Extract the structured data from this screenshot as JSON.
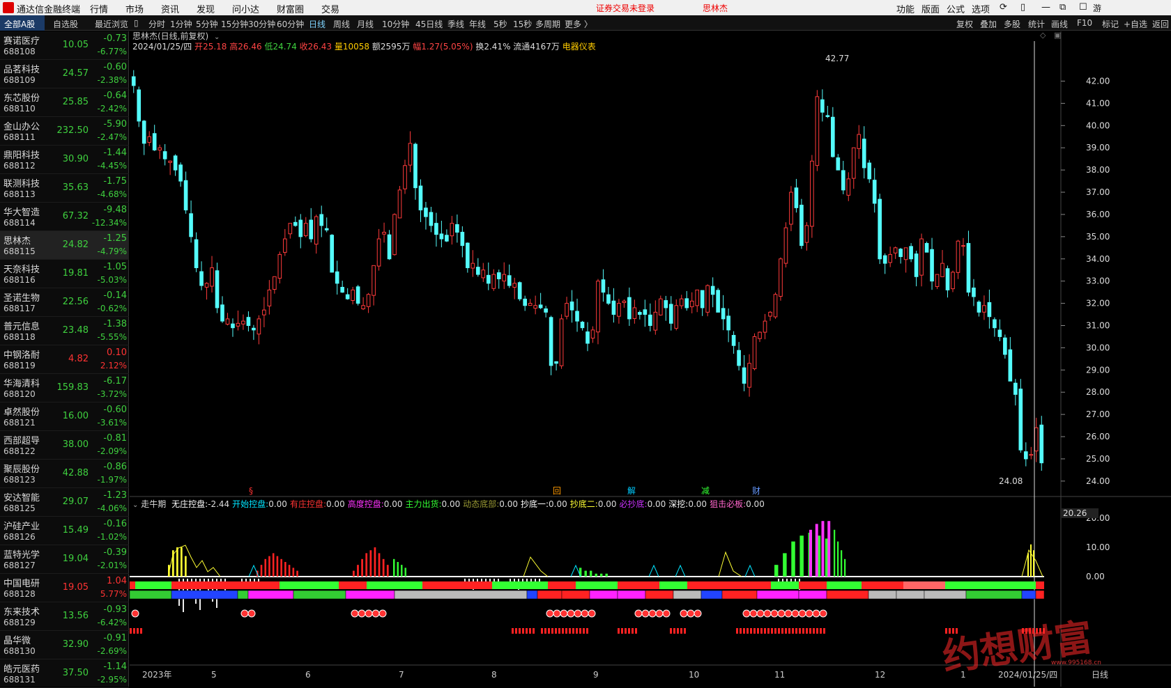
{
  "menubar": {
    "app_title": "通达信金融终端",
    "items": [
      "行情",
      "市场",
      "资讯",
      "发现",
      "问小达",
      "财富圈",
      "交易"
    ],
    "notice": "证券交易未登录",
    "current_stock": "思林杰",
    "tools": [
      "功能",
      "版面",
      "公式",
      "选项"
    ],
    "user": "游客"
  },
  "left_tabs": [
    "全部A股",
    "自选股",
    "最近浏览"
  ],
  "period_tabs": [
    "分时",
    "1分钟",
    "5分钟",
    "15分钟",
    "30分钟",
    "60分钟",
    "日线",
    "周线",
    "月线",
    "10分钟",
    "45日线",
    "季线",
    "年线",
    "5秒",
    "15秒",
    "多周期",
    "更多 〉"
  ],
  "active_period": "日线",
  "right_buttons": [
    "复权",
    "叠加",
    "多股",
    "统计",
    "画线",
    "F10",
    "标记",
    "+自选",
    "返回"
  ],
  "stocks": [
    {
      "name": "赛诺医疗",
      "code": "688108",
      "price": "10.05",
      "change": "-0.73",
      "pct": "-6.77%"
    },
    {
      "name": "品茗科技",
      "code": "688109",
      "price": "24.57",
      "change": "-0.60",
      "pct": "-2.38%"
    },
    {
      "name": "东芯股份",
      "code": "688110",
      "price": "25.85",
      "change": "-0.64",
      "pct": "-2.42%"
    },
    {
      "name": "金山办公",
      "code": "688111",
      "price": "232.50",
      "change": "-5.90",
      "pct": "-2.47%"
    },
    {
      "name": "鼎阳科技",
      "code": "688112",
      "price": "30.90",
      "change": "-1.44",
      "pct": "-4.45%"
    },
    {
      "name": "联测科技",
      "code": "688113",
      "price": "35.63",
      "change": "-1.75",
      "pct": "-4.68%"
    },
    {
      "name": "华大智造",
      "code": "688114",
      "price": "67.32",
      "change": "-9.48",
      "pct": "-12.34%"
    },
    {
      "name": "思林杰",
      "code": "688115",
      "price": "24.82",
      "change": "-1.25",
      "pct": "-4.79%"
    },
    {
      "name": "天奈科技",
      "code": "688116",
      "price": "19.81",
      "change": "-1.05",
      "pct": "-5.03%"
    },
    {
      "name": "圣诺生物",
      "code": "688117",
      "price": "22.56",
      "change": "-0.14",
      "pct": "-0.62%"
    },
    {
      "name": "普元信息",
      "code": "688118",
      "price": "23.48",
      "change": "-1.38",
      "pct": "-5.55%"
    },
    {
      "name": "中钢洛耐",
      "code": "688119",
      "price": "4.82",
      "change": "0.10",
      "pct": "2.12%"
    },
    {
      "name": "华海清科",
      "code": "688120",
      "price": "159.83",
      "change": "-6.17",
      "pct": "-3.72%"
    },
    {
      "name": "卓然股份",
      "code": "688121",
      "price": "16.00",
      "change": "-0.60",
      "pct": "-3.61%"
    },
    {
      "name": "西部超导",
      "code": "688122",
      "price": "38.00",
      "change": "-0.81",
      "pct": "-2.09%"
    },
    {
      "name": "聚辰股份",
      "code": "688123",
      "price": "42.88",
      "change": "-0.86",
      "pct": "-1.97%"
    },
    {
      "name": "安达智能",
      "code": "688125",
      "price": "29.07",
      "change": "-1.23",
      "pct": "-4.06%"
    },
    {
      "name": "沪硅产业",
      "code": "688126",
      "price": "15.49",
      "change": "-0.16",
      "pct": "-1.02%"
    },
    {
      "name": "蓝特光学",
      "code": "688127",
      "price": "19.04",
      "change": "-0.39",
      "pct": "-2.01%"
    },
    {
      "name": "中国电研",
      "code": "688128",
      "price": "19.05",
      "change": "1.04",
      "pct": "5.77%"
    },
    {
      "name": "东来技术",
      "code": "688129",
      "price": "13.56",
      "change": "-0.93",
      "pct": "-6.42%"
    },
    {
      "name": "晶华微",
      "code": "688130",
      "price": "32.90",
      "change": "-0.91",
      "pct": "-2.69%"
    },
    {
      "name": "皓元医药",
      "code": "688131",
      "price": "37.50",
      "change": "-1.14",
      "pct": "-2.95%"
    }
  ],
  "selected_index": 7,
  "chart_header": {
    "title": "思林杰(日线,前复权)",
    "date": "2024/01/25/四",
    "open_label": "开",
    "open": "25.18",
    "high_label": "高",
    "high": "26.46",
    "low_label": "低",
    "low": "24.74",
    "close_label": "收",
    "close": "26.43",
    "vol_label": "量",
    "vol": "10058",
    "amount_label": "额",
    "amount": "2595万",
    "range_label": "幅",
    "range": "1.27(5.05%)",
    "turn_label": "换",
    "turn": "2.41%",
    "float_label": "流通",
    "float": "4167万",
    "sector": "电器仪表"
  },
  "indicator_line": {
    "name": "走牛期",
    "items": [
      {
        "label": "无庄控盘:",
        "value": "-2.44",
        "color": "#ffffff"
      },
      {
        "label": "开始控盘:",
        "value": "0.00",
        "color": "#00e5ff"
      },
      {
        "label": "有庄控盘:",
        "value": "0.00",
        "color": "#ff3333"
      },
      {
        "label": "高度控盘:",
        "value": "0.00",
        "color": "#ff33ff"
      },
      {
        "label": "主力出货:",
        "value": "0.00",
        "color": "#33ff33"
      },
      {
        "label": "动态底部:",
        "value": "0.00",
        "color": "#999933"
      },
      {
        "label": "抄底一:",
        "value": "0.00",
        "color": "#ffffff"
      },
      {
        "label": "抄底二:",
        "value": "0.00",
        "color": "#ffff33"
      },
      {
        "label": "必抄底:",
        "value": "0.00",
        "color": "#cc33ff"
      },
      {
        "label": "深挖:",
        "value": "0.00",
        "color": "#ffffff"
      },
      {
        "label": "狙击必板:",
        "value": "0.00",
        "color": "#ff66cc"
      }
    ]
  },
  "chart_data": {
    "type": "candlestick",
    "y_ticks": [
      "42.00",
      "41.00",
      "40.00",
      "39.00",
      "38.00",
      "37.00",
      "36.00",
      "35.00",
      "34.00",
      "33.00",
      "32.00",
      "31.00",
      "30.00",
      "29.00",
      "28.00",
      "27.00",
      "26.00",
      "25.00",
      "24.00"
    ],
    "ylim": [
      23.4,
      43.3
    ],
    "max_marker": "42.77",
    "min_marker": "24.08",
    "x_labels": [
      "2023年",
      "5",
      "6",
      "7",
      "8",
      "9",
      "10",
      "11",
      "12",
      "1",
      "2024/01/25/四",
      "日线"
    ],
    "closes": [
      41.8,
      40.2,
      39.2,
      39.5,
      38.9,
      39.0,
      38.5,
      38.4,
      38.0,
      37.5,
      36.2,
      35.0,
      33.6,
      32.8,
      32.9,
      33.6,
      31.8,
      31.2,
      31.3,
      30.9,
      31.1,
      31.2,
      31.0,
      30.8,
      31.3,
      31.7,
      32.6,
      33.2,
      34.2,
      34.9,
      35.6,
      35.5,
      35.0,
      35.6,
      34.9,
      35.9,
      35.5,
      35.3,
      33.4,
      32.9,
      32.5,
      32.2,
      32.6,
      32.0,
      31.9,
      32.4,
      33.7,
      34.9,
      35.2,
      34.0,
      36.0,
      37.1,
      38.2,
      39.2,
      37.2,
      36.2,
      35.9,
      35.5,
      35.1,
      34.9,
      34.8,
      35.6,
      35.2,
      34.6,
      33.6,
      33.8,
      33.3,
      33.5,
      32.9,
      33.3,
      33.1,
      33.3,
      32.8,
      32.9,
      32.2,
      31.9,
      32.0,
      31.9,
      31.8,
      31.6,
      29.2,
      29.3,
      31.3,
      32.0,
      31.7,
      31.2,
      30.9,
      30.2,
      30.8,
      33.0,
      32.5,
      32.0,
      31.5,
      32.0,
      32.1,
      31.3,
      31.8,
      31.5,
      31.5,
      31.0,
      31.6,
      32.2,
      31.8,
      31.1,
      31.9,
      32.2,
      31.8,
      32.1,
      32.6,
      31.8,
      32.8,
      32.4,
      31.6,
      31.3,
      30.8,
      30.1,
      29.2,
      28.4,
      29.3,
      30.5,
      30.7,
      31.2,
      31.6,
      32.4,
      34.0,
      35.4,
      37.0,
      36.3,
      34.6,
      35.5,
      38.4,
      41.3,
      40.6,
      40.4,
      38.6,
      38.0,
      37.1,
      37.6,
      39.0,
      39.6,
      38.1,
      37.6,
      36.5,
      34.0,
      33.8,
      34.2,
      34.5,
      34.1,
      34.5,
      34.0,
      33.2,
      34.9,
      34.3,
      33.0,
      33.3,
      33.8,
      32.6,
      33.4,
      34.8,
      34.6,
      32.5,
      32.3,
      31.6,
      31.9,
      31.4,
      30.9,
      30.5,
      29.7,
      28.5,
      27.9,
      25.4,
      25.0,
      25.2,
      26.4,
      24.82
    ]
  },
  "right_axis": {
    "sub_value": "20.26",
    "sub_ticks": [
      "20.00",
      "10.00",
      "0.00"
    ]
  },
  "signal_markers": [
    "§",
    "回",
    "解",
    "减",
    "财"
  ],
  "watermark": "约想财富",
  "watermark_url": "www.995168.cn"
}
